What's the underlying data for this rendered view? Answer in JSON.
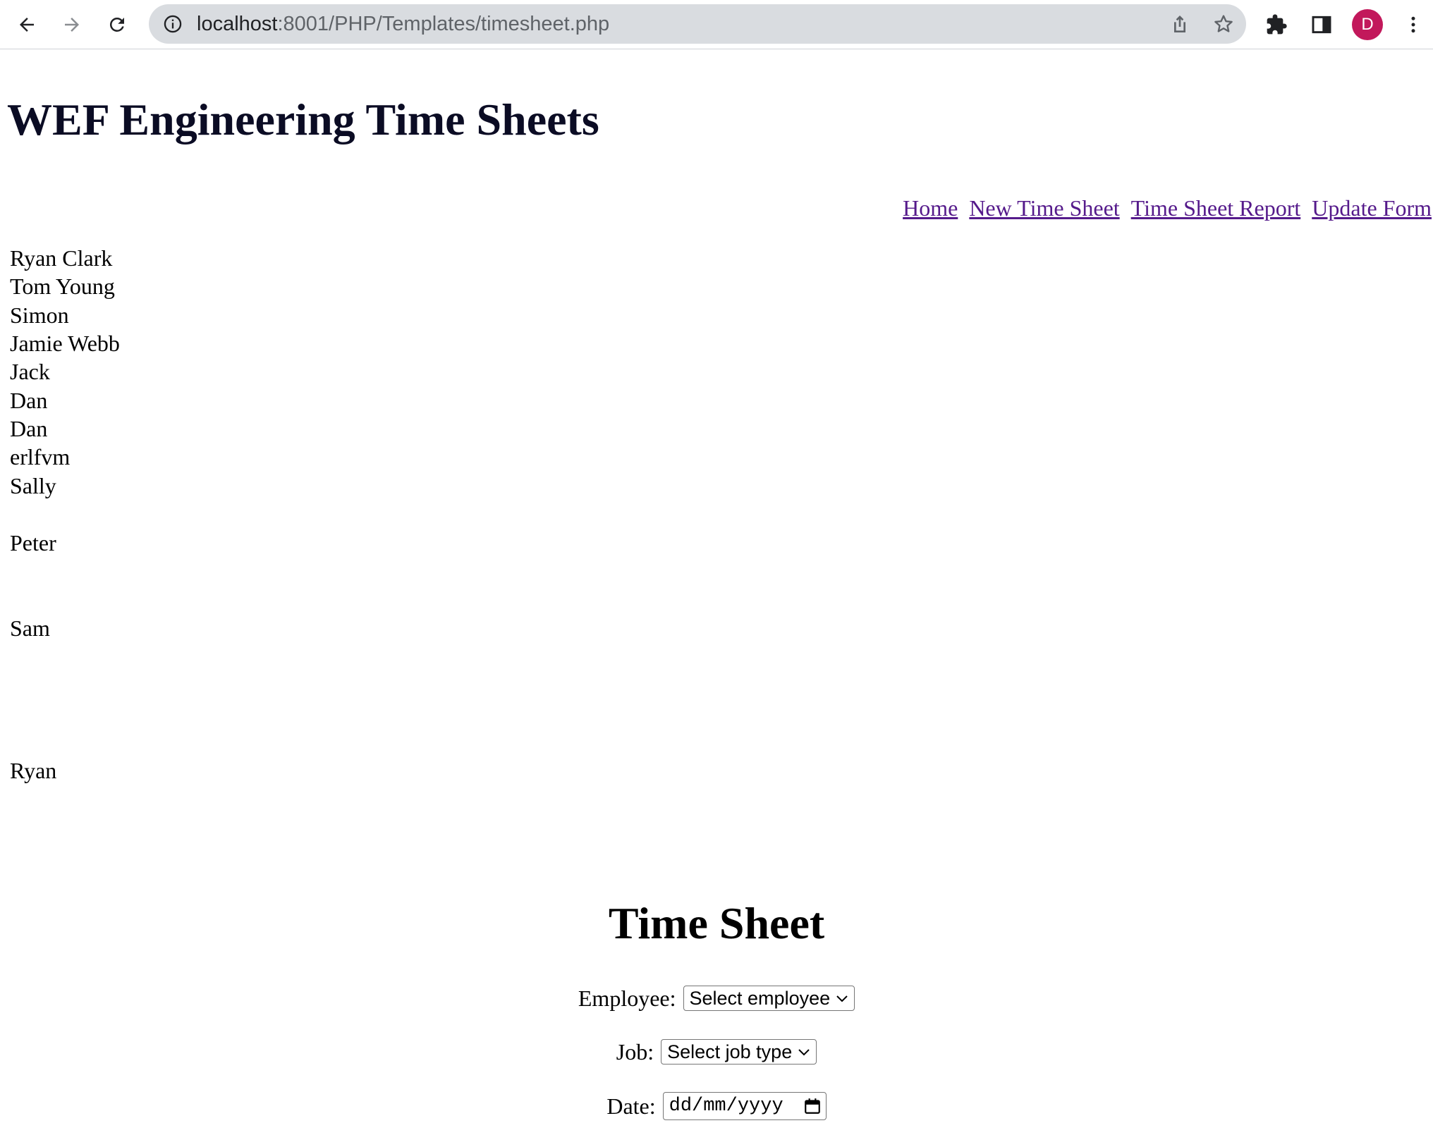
{
  "browser": {
    "url_host": "localhost",
    "url_rest": ":8001/PHP/Templates/timesheet.php",
    "avatar_letter": "D",
    "avatar_color": "#c2185b"
  },
  "site": {
    "title": "WEF Engineering Time Sheets"
  },
  "nav": {
    "items": [
      "Home",
      "New Time Sheet",
      "Time Sheet Report",
      "Update Form"
    ],
    "link_color": "#551a8b"
  },
  "employees": [
    "Ryan Clark",
    "Tom Young",
    "Simon",
    "Jamie Webb",
    "Jack",
    "Dan",
    "Dan",
    "erlfvm",
    "Sally",
    "Peter",
    "Sam",
    "Ryan"
  ],
  "form": {
    "title": "Time Sheet",
    "employee_label": "Employee:",
    "employee_select": "Select employee",
    "job_label": "Job:",
    "job_select": "Select job type",
    "date_label": "Date:",
    "date_placeholder": "dd/mm/yyyy"
  }
}
